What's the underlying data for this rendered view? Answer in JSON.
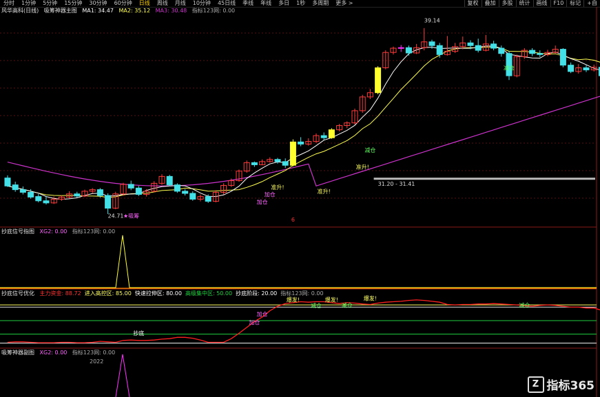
{
  "toolbar": {
    "periods": [
      "分时",
      "1分钟",
      "5分钟",
      "15分钟",
      "30分钟",
      "60分钟",
      "日线",
      "周线",
      "月线",
      "10分钟",
      "45日线",
      "季线",
      "年线",
      "多日",
      "1秒",
      "多周期",
      "更多 >"
    ],
    "active_period": 6,
    "right_tabs": [
      "复权",
      "叠加",
      "多股",
      "统计",
      "画线",
      "F10",
      "标记",
      "+自"
    ]
  },
  "main_panel": {
    "title": "风华高科(日线)",
    "indicator": "吸筹神器主图",
    "ma1": "MA1: 34.47",
    "ma2": "MA2: 35.12",
    "ma3": "MA3: 30.48",
    "credit": "指标123网: 0.00",
    "colors": {
      "up": "#ff3b3b",
      "down": "#44e0e8",
      "ma1": "#ffffff",
      "ma2": "#ffff50",
      "ma3": "#cc33cc"
    }
  },
  "panel2": {
    "title": "抄底信号指图",
    "xg": "XG2: 0.00",
    "credit": "指标123网: 0.00"
  },
  "panel3": {
    "title": "抄底信号优化",
    "items": [
      {
        "text": "主力资金: 88.72",
        "color": "#ff3030"
      },
      {
        "text": "进入高控区: 85.00",
        "color": "#ffff60"
      },
      {
        "text": "快速拉伸区: 80.00",
        "color": "#ffffff"
      },
      {
        "text": "高级集中区: 50.00",
        "color": "#20d040"
      },
      {
        "text": "抄底阶段: 20.00",
        "color": "#ffffff"
      },
      {
        "text": "指标123网: 0.00",
        "color": "#aaaaaa"
      }
    ]
  },
  "panel4": {
    "title": "吸筹神器副图",
    "xg": "XG2: 0.00",
    "credit": "指标123网: 0.00",
    "year": "2022"
  },
  "logo": {
    "text": "指标365",
    "mark": "Z"
  },
  "chart_data": [
    {
      "type": "candlestick",
      "name": "main",
      "candles": [
        [
          31.5,
          30.0,
          32.0,
          29.8
        ],
        [
          30.2,
          29.3,
          30.8,
          28.9
        ],
        [
          29.3,
          28.8,
          29.9,
          28.4
        ],
        [
          28.8,
          27.9,
          29.4,
          27.6
        ],
        [
          28.0,
          27.2,
          28.5,
          26.9
        ],
        [
          27.2,
          26.8,
          28.0,
          26.5
        ],
        [
          26.8,
          27.5,
          28.0,
          26.6
        ],
        [
          27.5,
          27.9,
          28.2,
          27.2
        ],
        [
          27.9,
          28.5,
          29.0,
          27.7
        ],
        [
          28.5,
          28.1,
          28.9,
          27.8
        ],
        [
          28.1,
          29.0,
          29.3,
          27.9
        ],
        [
          29.0,
          29.3,
          29.6,
          28.6
        ],
        [
          29.3,
          28.2,
          29.6,
          27.8
        ],
        [
          28.2,
          25.8,
          28.6,
          24.71
        ],
        [
          25.8,
          28.5,
          28.9,
          25.6
        ],
        [
          28.5,
          30.3,
          30.6,
          28.2
        ],
        [
          30.3,
          29.6,
          31.0,
          29.2
        ],
        [
          29.6,
          28.4,
          30.0,
          28.1
        ],
        [
          28.4,
          29.0,
          29.4,
          28.0
        ],
        [
          29.0,
          30.5,
          30.9,
          28.8
        ],
        [
          30.5,
          31.8,
          32.2,
          30.2
        ],
        [
          31.8,
          30.2,
          32.1,
          29.9
        ],
        [
          30.2,
          29.0,
          30.5,
          28.7
        ],
        [
          29.0,
          28.6,
          29.4,
          28.2
        ],
        [
          28.6,
          27.5,
          29.0,
          27.2
        ],
        [
          27.5,
          28.0,
          28.4,
          27.1
        ],
        [
          28.0,
          27.1,
          28.4,
          26.8
        ],
        [
          27.1,
          28.8,
          29.2,
          26.9
        ],
        [
          28.8,
          30.1,
          30.5,
          28.4
        ],
        [
          30.1,
          31.0,
          31.4,
          29.8
        ],
        [
          31.0,
          32.8,
          33.1,
          30.8
        ],
        [
          32.8,
          34.4,
          34.8,
          32.5
        ],
        [
          34.4,
          34.0,
          34.6,
          33.6
        ],
        [
          34.0,
          34.6,
          35.0,
          33.9
        ],
        [
          34.6,
          35.0,
          35.4,
          34.4
        ],
        [
          35.0,
          34.6,
          35.3,
          34.2
        ],
        [
          34.6,
          33.9,
          35.2,
          33.4
        ],
        [
          33.9,
          38.3,
          38.8,
          33.7
        ],
        [
          38.3,
          37.9,
          39.2,
          37.5
        ],
        [
          37.9,
          38.4,
          39.0,
          37.6
        ],
        [
          38.4,
          39.5,
          39.9,
          38.1
        ],
        [
          39.5,
          39.1,
          40.1,
          38.7
        ],
        [
          39.1,
          40.6,
          40.9,
          38.9
        ],
        [
          40.6,
          41.4,
          41.7,
          40.3
        ],
        [
          41.4,
          41.9,
          42.2,
          40.9
        ],
        [
          41.9,
          44.2,
          44.6,
          41.6
        ],
        [
          44.2,
          46.8,
          47.2,
          43.8
        ],
        [
          46.8,
          47.6,
          48.3,
          46.4
        ],
        [
          47.6,
          52.3,
          52.6,
          47.3
        ],
        [
          52.3,
          55.2,
          55.6,
          52.0
        ],
        [
          55.2,
          56.0,
          56.3,
          54.8
        ],
        [
          56.0,
          56.1,
          56.6,
          55.3
        ],
        [
          56.1,
          55.1,
          56.5,
          54.6
        ],
        [
          55.1,
          56.1,
          56.8,
          54.9
        ],
        [
          56.1,
          57.2,
          59.8,
          55.6
        ],
        [
          57.2,
          56.5,
          57.6,
          55.9
        ],
        [
          56.5,
          54.8,
          57.0,
          54.2
        ],
        [
          54.8,
          55.4,
          58.3,
          54.6
        ],
        [
          55.4,
          56.3,
          57.0,
          55.1
        ],
        [
          56.3,
          57.0,
          58.2,
          55.8
        ],
        [
          57.0,
          56.5,
          57.5,
          55.8
        ],
        [
          56.5,
          55.6,
          57.8,
          55.2
        ],
        [
          55.6,
          56.8,
          58.5,
          55.4
        ],
        [
          56.8,
          56.0,
          57.4,
          55.6
        ],
        [
          56.0,
          55.0,
          56.5,
          54.4
        ],
        [
          55.0,
          50.8,
          55.4,
          50.0
        ],
        [
          50.8,
          54.4,
          54.8,
          50.5
        ],
        [
          54.4,
          55.6,
          56.0,
          54.0
        ],
        [
          55.6,
          55.0,
          56.0,
          54.5
        ],
        [
          55.0,
          54.8,
          55.6,
          54.3
        ],
        [
          54.8,
          55.2,
          55.7,
          54.5
        ],
        [
          55.2,
          55.8,
          56.5,
          55.0
        ],
        [
          55.8,
          52.8,
          56.0,
          52.4
        ],
        [
          52.8,
          51.6,
          53.3,
          51.3
        ],
        [
          51.6,
          52.3,
          53.0,
          51.2
        ],
        [
          52.3,
          51.9,
          52.8,
          51.5
        ],
        [
          51.9,
          52.4,
          52.9,
          51.6
        ],
        [
          52.4,
          50.8,
          52.7,
          50.3
        ]
      ],
      "ylim": [
        22.5,
        62.5
      ],
      "annotations": [
        {
          "text": "39.14",
          "at": "high"
        },
        {
          "text": "24.71",
          "at": "low"
        },
        {
          "text": "31.20 - 31.41",
          "at": "level"
        },
        {
          "text": "准升!",
          "color": "#ffff60"
        },
        {
          "text": "准升!",
          "color": "#ffff60"
        },
        {
          "text": "准升!",
          "color": "#ffff60"
        },
        {
          "text": "减仓",
          "color": "#60ff60"
        },
        {
          "text": "减仓",
          "color": "#60ff60"
        },
        {
          "text": "加仓",
          "color": "#ff60ff"
        },
        {
          "text": "加仓",
          "color": "#ff60ff"
        },
        {
          "text": "★吸筹",
          "color": "#ff60ff"
        },
        {
          "text": "6",
          "color": "#ff3030"
        }
      ]
    },
    {
      "type": "line",
      "name": "panel2",
      "values": [
        0,
        0,
        0,
        0,
        0,
        0,
        0,
        0,
        0,
        0,
        0,
        0,
        0,
        0,
        0,
        0,
        0,
        0,
        0,
        0,
        0,
        0,
        0,
        0,
        0,
        0,
        0,
        0,
        0,
        0,
        0,
        0,
        0,
        0,
        0,
        0,
        0,
        0,
        0,
        0,
        0,
        0,
        0,
        0,
        0,
        0,
        0,
        0,
        0,
        0,
        0,
        0,
        0,
        0,
        0,
        0,
        0,
        0,
        0,
        0,
        0,
        0,
        0,
        0,
        0,
        0,
        0,
        0,
        0,
        0,
        0,
        0,
        0,
        0,
        0,
        0,
        0,
        0
      ],
      "spike_index": 12,
      "spike_value": 1
    },
    {
      "type": "line",
      "name": "panel3",
      "series": [
        {
          "name": "主力资金",
          "values": [
            2,
            3,
            3,
            2,
            1,
            1,
            1,
            2,
            2,
            1,
            1,
            2,
            4,
            3,
            2,
            6,
            7,
            6,
            6,
            7,
            9,
            10,
            13,
            13,
            11,
            7,
            2,
            2,
            2,
            10,
            22,
            35,
            48,
            58,
            72,
            82,
            88,
            90,
            92,
            91,
            92,
            92,
            90,
            88,
            90,
            89,
            87,
            86,
            89,
            91,
            92,
            93,
            95,
            96,
            95,
            93,
            91,
            86,
            85,
            86,
            86,
            87,
            87,
            88,
            87,
            86,
            85,
            83,
            82,
            84,
            85,
            84,
            82,
            80,
            80,
            78,
            78,
            73
          ]
        }
      ],
      "levels": [
        85,
        80,
        50,
        20,
        0
      ],
      "ylim": [
        -8,
        102
      ],
      "annotations": [
        {
          "text": "爆发!",
          "color": "#ffff60"
        },
        {
          "text": "爆发!",
          "color": "#ffff60"
        },
        {
          "text": "爆发!",
          "color": "#ffff60"
        },
        {
          "text": "减仓",
          "color": "#60ff60"
        },
        {
          "text": "减仓",
          "color": "#60ff60"
        },
        {
          "text": "减仓",
          "color": "#60ff60"
        },
        {
          "text": "加仓",
          "color": "#ff60ff"
        },
        {
          "text": "加仓",
          "color": "#ff60ff"
        },
        {
          "text": "抄底",
          "color": "#ffffff"
        }
      ]
    },
    {
      "type": "line",
      "name": "panel4",
      "values": [],
      "spike_index": 12,
      "spike_value": 1
    }
  ]
}
